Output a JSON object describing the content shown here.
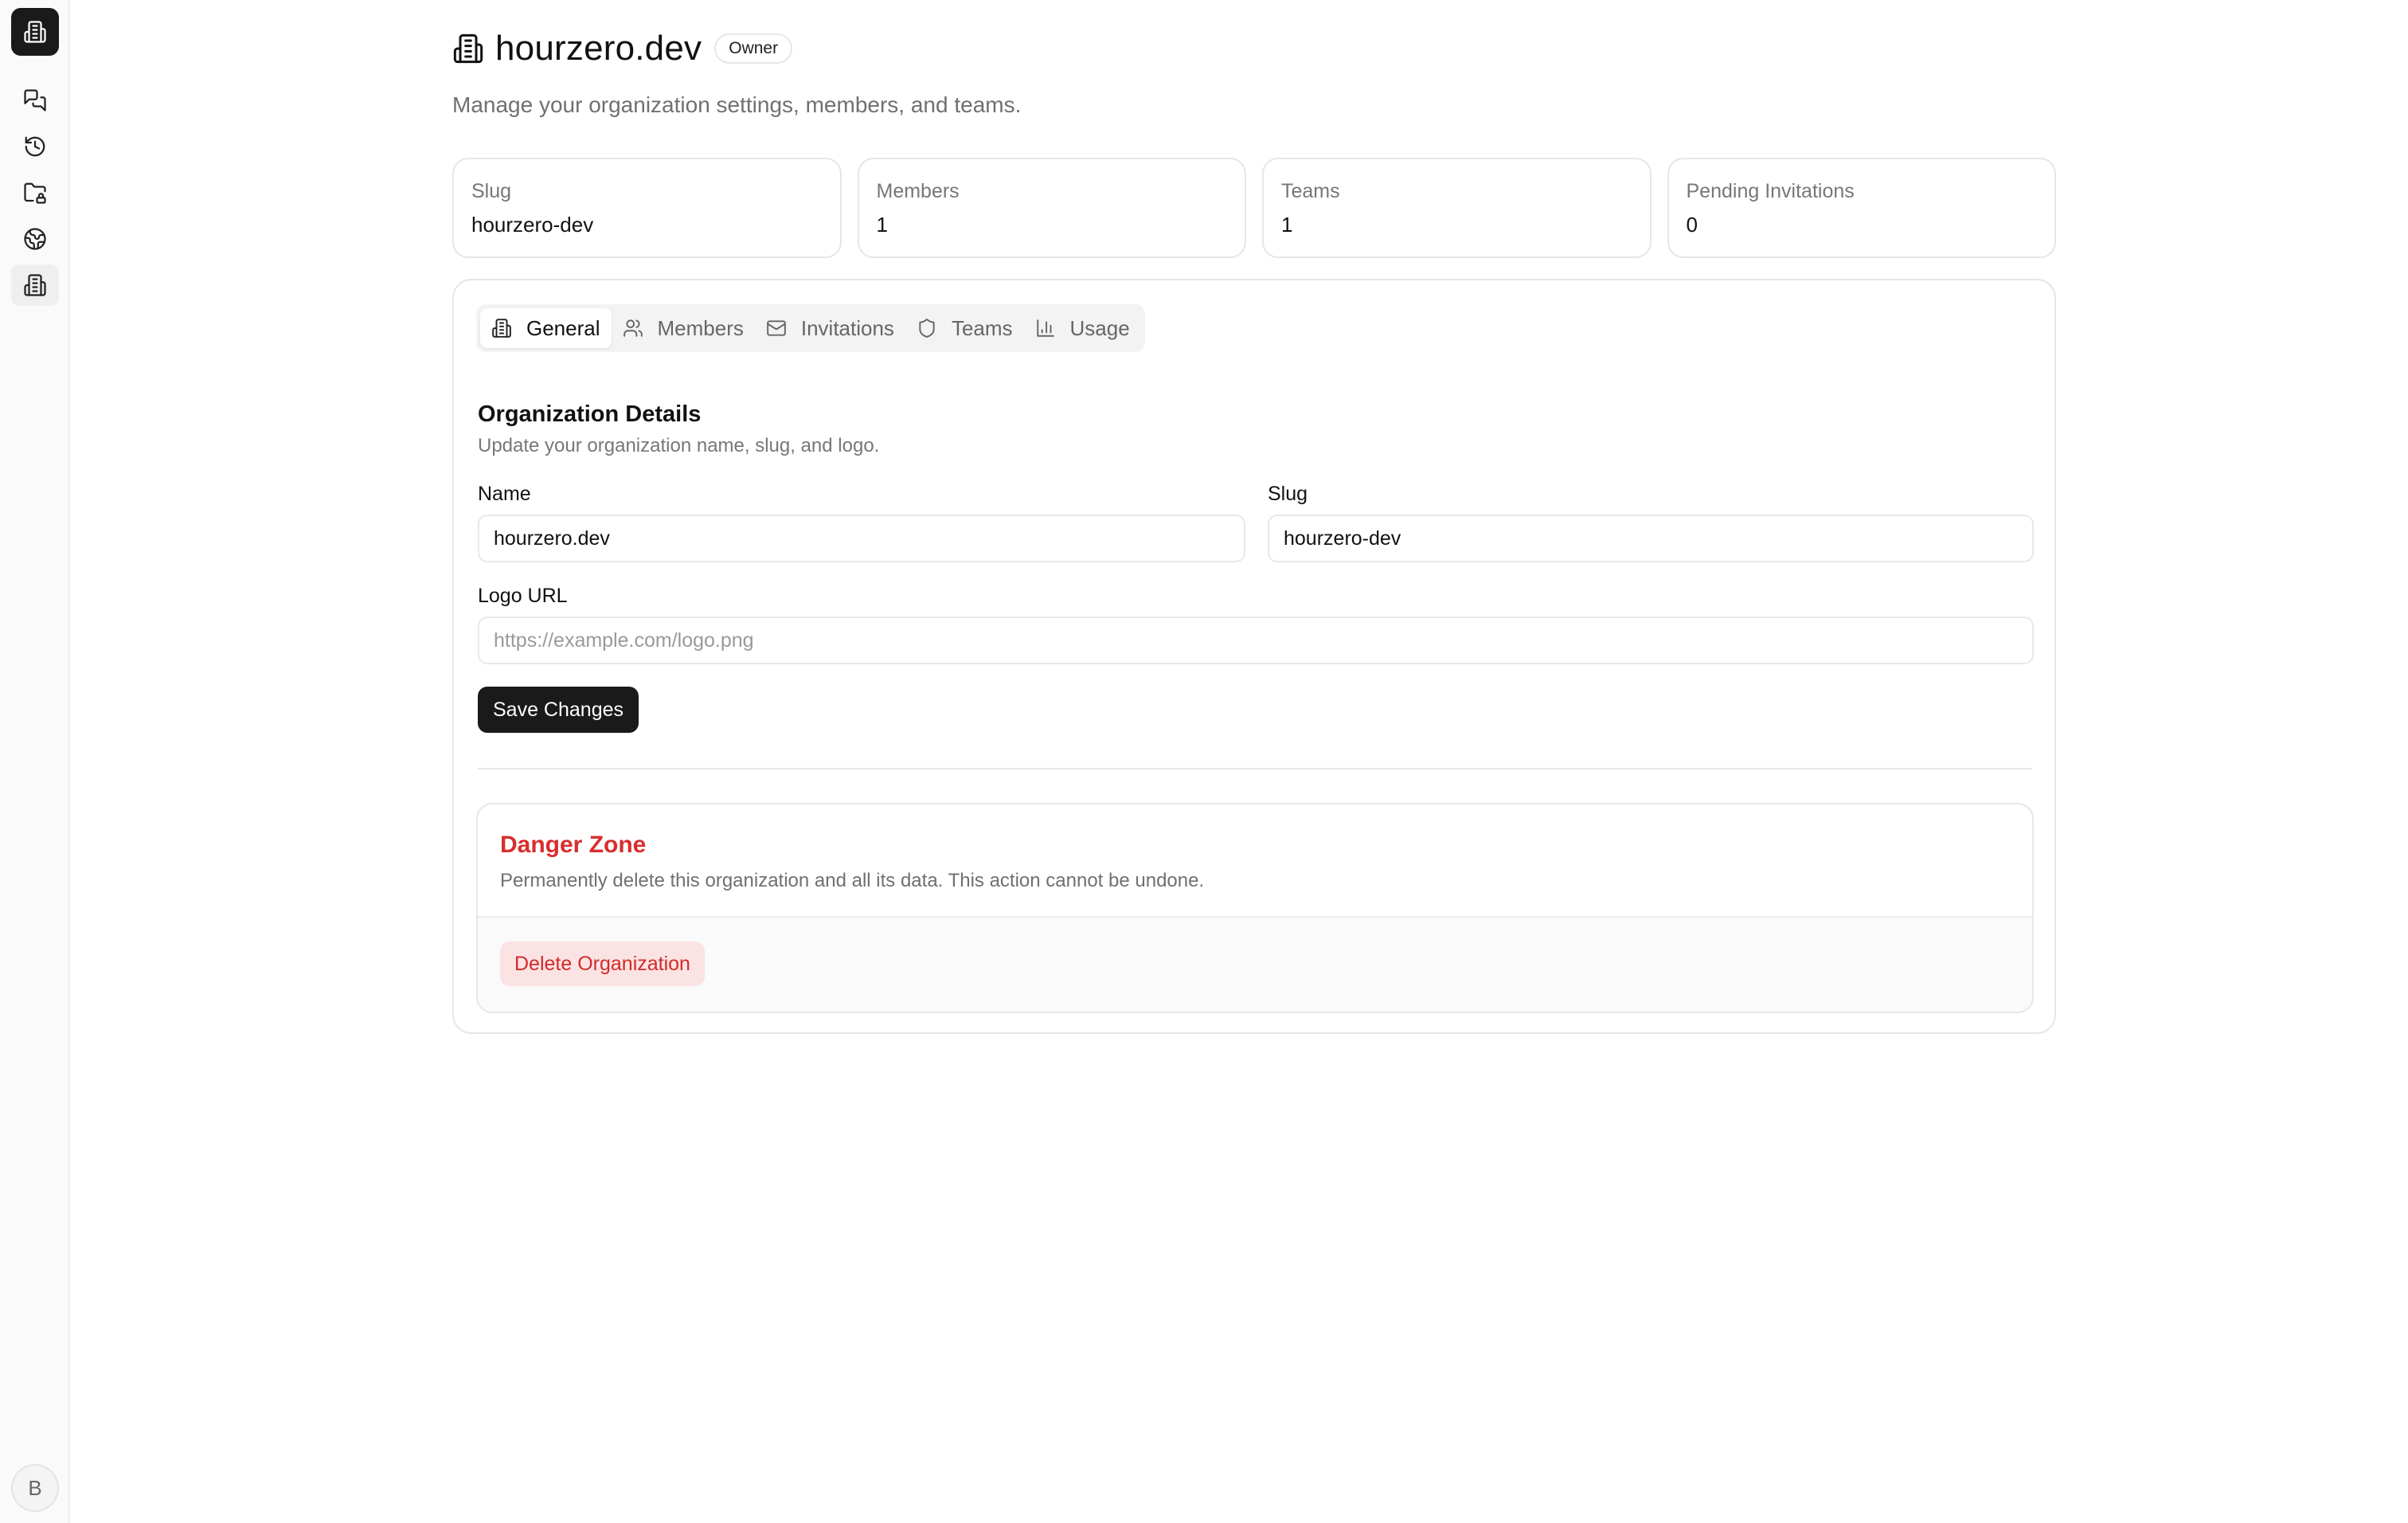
{
  "sidebar": {
    "logo_icon": "building-icon",
    "items": [
      {
        "icon": "chat-icon"
      },
      {
        "icon": "history-icon"
      },
      {
        "icon": "folder-lock-icon"
      },
      {
        "icon": "globe-icon"
      },
      {
        "icon": "building-icon",
        "active": true
      }
    ],
    "avatar_initial": "B"
  },
  "header": {
    "title": "hourzero.dev",
    "role_badge": "Owner",
    "subtitle": "Manage your organization settings, members, and teams."
  },
  "stats": [
    {
      "label": "Slug",
      "value": "hourzero-dev"
    },
    {
      "label": "Members",
      "value": "1"
    },
    {
      "label": "Teams",
      "value": "1"
    },
    {
      "label": "Pending Invitations",
      "value": "0"
    }
  ],
  "tabs": [
    {
      "label": "General",
      "icon": "building-icon",
      "active": true
    },
    {
      "label": "Members",
      "icon": "users-icon"
    },
    {
      "label": "Invitations",
      "icon": "mail-icon"
    },
    {
      "label": "Teams",
      "icon": "shield-icon"
    },
    {
      "label": "Usage",
      "icon": "bar-chart-icon"
    }
  ],
  "org_details": {
    "title": "Organization Details",
    "description": "Update your organization name, slug, and logo.",
    "name_label": "Name",
    "name_value": "hourzero.dev",
    "slug_label": "Slug",
    "slug_value": "hourzero-dev",
    "logo_label": "Logo URL",
    "logo_value": "",
    "logo_placeholder": "https://example.com/logo.png",
    "save_label": "Save Changes"
  },
  "danger_zone": {
    "title": "Danger Zone",
    "description": "Permanently delete this organization and all its data. This action cannot be undone.",
    "delete_label": "Delete Organization"
  },
  "colors": {
    "primary_button": "#1a1a1a",
    "danger_text": "#d92d2d",
    "danger_button_bg": "#fbe3e3",
    "border": "#e6e6e6"
  }
}
